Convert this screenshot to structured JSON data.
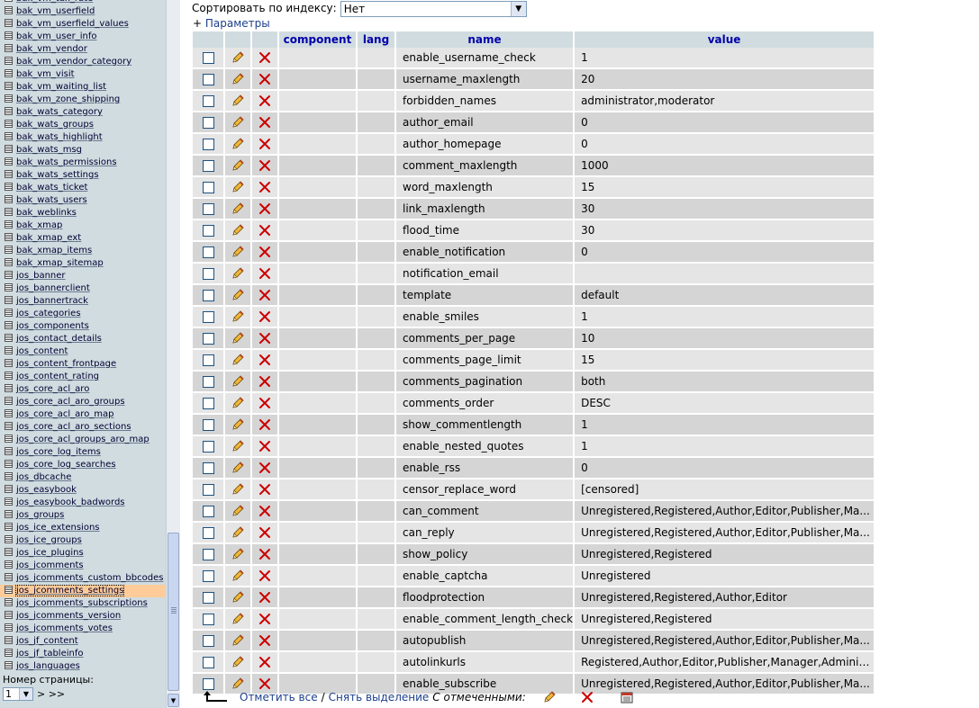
{
  "left": {
    "tables": [
      "bak_vm_tax_rate",
      "bak_vm_userfield",
      "bak_vm_userfield_values",
      "bak_vm_user_info",
      "bak_vm_vendor",
      "bak_vm_vendor_category",
      "bak_vm_visit",
      "bak_vm_waiting_list",
      "bak_vm_zone_shipping",
      "bak_wats_category",
      "bak_wats_groups",
      "bak_wats_highlight",
      "bak_wats_msg",
      "bak_wats_permissions",
      "bak_wats_settings",
      "bak_wats_ticket",
      "bak_wats_users",
      "bak_weblinks",
      "bak_xmap",
      "bak_xmap_ext",
      "bak_xmap_items",
      "bak_xmap_sitemap",
      "jos_banner",
      "jos_bannerclient",
      "jos_bannertrack",
      "jos_categories",
      "jos_components",
      "jos_contact_details",
      "jos_content",
      "jos_content_frontpage",
      "jos_content_rating",
      "jos_core_acl_aro",
      "jos_core_acl_aro_groups",
      "jos_core_acl_aro_map",
      "jos_core_acl_aro_sections",
      "jos_core_acl_groups_aro_map",
      "jos_core_log_items",
      "jos_core_log_searches",
      "jos_dbcache",
      "jos_easybook",
      "jos_easybook_badwords",
      "jos_groups",
      "jos_ice_extensions",
      "jos_ice_groups",
      "jos_ice_plugins",
      "jos_jcomments",
      "jos_jcomments_custom_bbcodes",
      "jos_jcomments_settings",
      "jos_jcomments_subscriptions",
      "jos_jcomments_version",
      "jos_jcomments_votes",
      "jos_jf_content",
      "jos_jf_tableinfo",
      "jos_languages"
    ],
    "selected_table": "jos_jcomments_settings",
    "pager_label": "Номер страницы:",
    "pager_value": "1",
    "pager_next": "> >>"
  },
  "top": {
    "sort_label": "Сортировать по индексу:",
    "sort_value": "Нет",
    "params_plus": "+",
    "params_link": "Параметры"
  },
  "table": {
    "columns": [
      "component",
      "lang",
      "name",
      "value"
    ],
    "rows": [
      {
        "name": "enable_username_check",
        "value": "1"
      },
      {
        "name": "username_maxlength",
        "value": "20"
      },
      {
        "name": "forbidden_names",
        "value": "administrator,moderator"
      },
      {
        "name": "author_email",
        "value": "0"
      },
      {
        "name": "author_homepage",
        "value": "0"
      },
      {
        "name": "comment_maxlength",
        "value": "1000"
      },
      {
        "name": "word_maxlength",
        "value": "15"
      },
      {
        "name": "link_maxlength",
        "value": "30"
      },
      {
        "name": "flood_time",
        "value": "30"
      },
      {
        "name": "enable_notification",
        "value": "0"
      },
      {
        "name": "notification_email",
        "value": ""
      },
      {
        "name": "template",
        "value": "default"
      },
      {
        "name": "enable_smiles",
        "value": "1"
      },
      {
        "name": "comments_per_page",
        "value": "10"
      },
      {
        "name": "comments_page_limit",
        "value": "15"
      },
      {
        "name": "comments_pagination",
        "value": "both"
      },
      {
        "name": "comments_order",
        "value": "DESC"
      },
      {
        "name": "show_commentlength",
        "value": "1"
      },
      {
        "name": "enable_nested_quotes",
        "value": "1"
      },
      {
        "name": "enable_rss",
        "value": "0"
      },
      {
        "name": "censor_replace_word",
        "value": "[censored]"
      },
      {
        "name": "can_comment",
        "value": "Unregistered,Registered,Author,Editor,Publisher,Ma..."
      },
      {
        "name": "can_reply",
        "value": "Unregistered,Registered,Author,Editor,Publisher,Ma..."
      },
      {
        "name": "show_policy",
        "value": "Unregistered,Registered"
      },
      {
        "name": "enable_captcha",
        "value": "Unregistered"
      },
      {
        "name": "floodprotection",
        "value": "Unregistered,Registered,Author,Editor"
      },
      {
        "name": "enable_comment_length_check",
        "value": "Unregistered,Registered"
      },
      {
        "name": "autopublish",
        "value": "Unregistered,Registered,Author,Editor,Publisher,Ma..."
      },
      {
        "name": "autolinkurls",
        "value": "Registered,Author,Editor,Publisher,Manager,Adminis..."
      },
      {
        "name": "enable_subscribe",
        "value": "Unregistered,Registered,Author,Editor,Publisher,Ma..."
      }
    ]
  },
  "bottom": {
    "check_all": "Отметить все",
    "separator": "/",
    "uncheck_all": "Снять выделение",
    "with_selected": "С отмеченными:"
  },
  "colors": {
    "header_bg": "#d1dce0",
    "row_odd": "#e5e5e5",
    "row_even": "#d5d5d5",
    "left_bg": "#d0dce0",
    "selected_bg": "#ffcc99",
    "delete_red": "#cc0000"
  },
  "icons": {
    "edit": "pencil-icon",
    "delete": "delete-x-icon",
    "table": "table-icon",
    "export": "export-icon",
    "arrow": "arrow-up-left-icon"
  }
}
